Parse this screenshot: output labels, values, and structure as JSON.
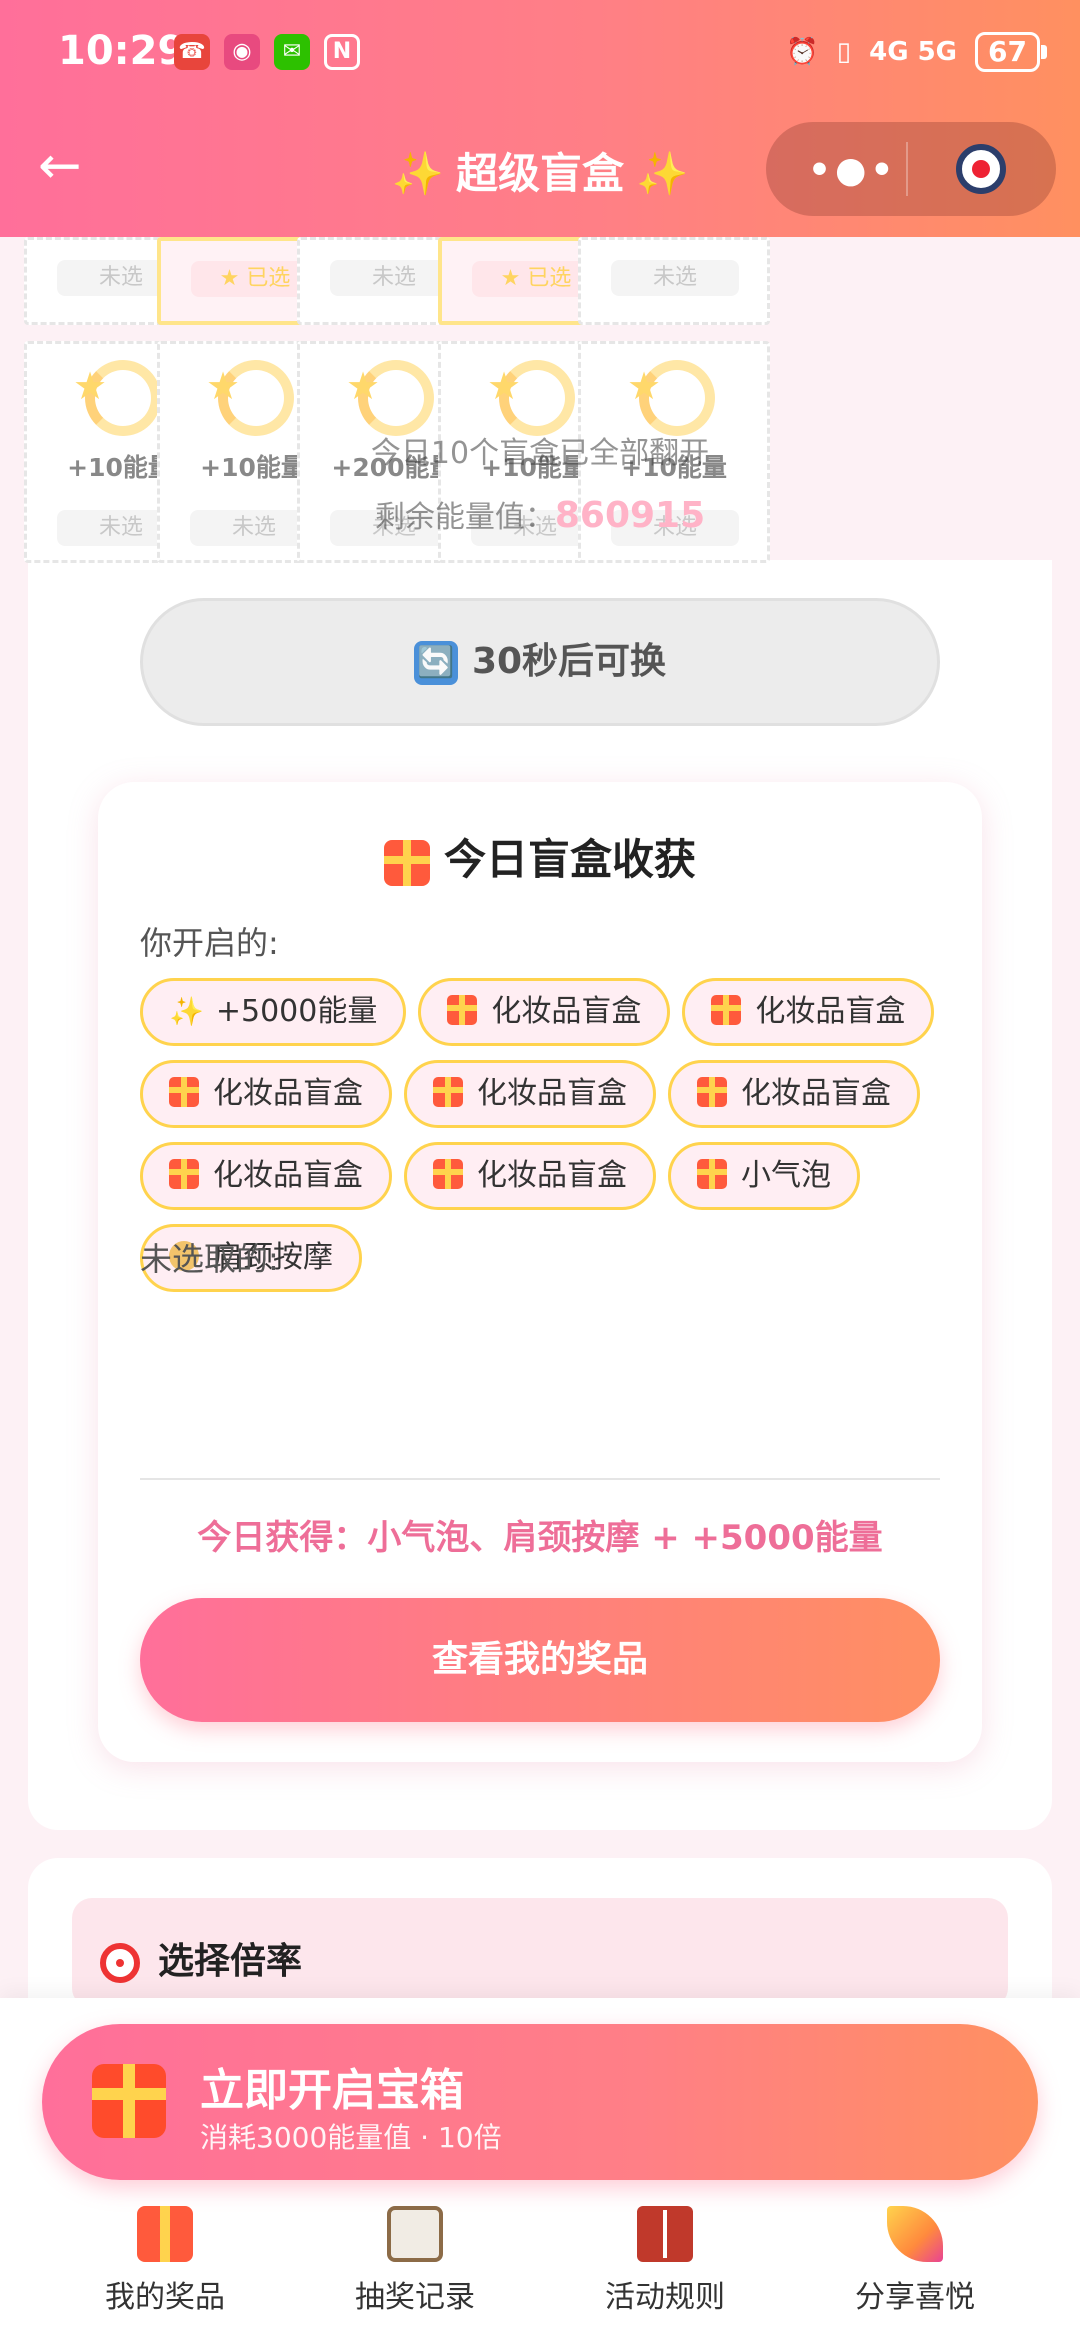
{
  "status_bar": {
    "time": "10:29",
    "network": "4G 5G",
    "battery": "67"
  },
  "header": {
    "back_label": "←",
    "title": "超级盲盒",
    "spark": "✨",
    "menu_dots": "•●•"
  },
  "grid": {
    "top_row": [
      {
        "tag": "未选",
        "selected": false
      },
      {
        "tag": "★ 已选",
        "selected": true
      },
      {
        "tag": "未选",
        "selected": false
      },
      {
        "tag": "★ 已选",
        "selected": true
      },
      {
        "tag": "未选",
        "selected": false
      }
    ],
    "bottom_row": [
      {
        "energy": "+10能量",
        "tag": "未选"
      },
      {
        "energy": "+10能量",
        "tag": "未选"
      },
      {
        "energy": "+200能量",
        "tag": "未选"
      },
      {
        "energy": "+10能量",
        "tag": "未选"
      },
      {
        "energy": "+10能量",
        "tag": "未选"
      }
    ],
    "overlay_line1": "今日10个盲盒已全部翻开",
    "overlay_line2_label": "剩余能量值：",
    "overlay_line2_value": "860915"
  },
  "swap_button": {
    "icon": "🔄",
    "label": "30秒后可换"
  },
  "harvest": {
    "title": "今日盲盒收获",
    "opened_label": "你开启的:",
    "chips": [
      {
        "icon": "spark",
        "text": "+5000能量"
      },
      {
        "icon": "gift",
        "text": "化妆品盲盒"
      },
      {
        "icon": "gift",
        "text": "化妆品盲盒"
      },
      {
        "icon": "gift",
        "text": "化妆品盲盒"
      },
      {
        "icon": "gift",
        "text": "化妆品盲盒"
      },
      {
        "icon": "gift",
        "text": "化妆品盲盒"
      },
      {
        "icon": "gift",
        "text": "化妆品盲盒"
      },
      {
        "icon": "gift",
        "text": "化妆品盲盒"
      },
      {
        "icon": "gift",
        "text": "小气泡"
      },
      {
        "icon": "person",
        "text": "肩颈按摩"
      }
    ],
    "unselected_label": "未选取的:",
    "today_summary": "今日获得：小气泡、肩颈按摩 + +5000能量",
    "view_button": "查看我的奖品"
  },
  "multiplier": {
    "title": "选择倍率"
  },
  "open_box": {
    "title": "立即开启宝箱",
    "subtitle": "消耗3000能量值 · 10倍"
  },
  "nav": [
    {
      "icon": "gift-icon",
      "label": "我的奖品"
    },
    {
      "icon": "clipboard-icon",
      "label": "抽奖记录"
    },
    {
      "icon": "book-icon",
      "label": "活动规则"
    },
    {
      "icon": "party-popper-icon",
      "label": "分享喜悦"
    }
  ],
  "colors": {
    "accent_pink": "#ff6f9a",
    "accent_orange": "#ff9060",
    "summary_pink": "#ee6e98",
    "chip_border": "#ffd34d"
  }
}
